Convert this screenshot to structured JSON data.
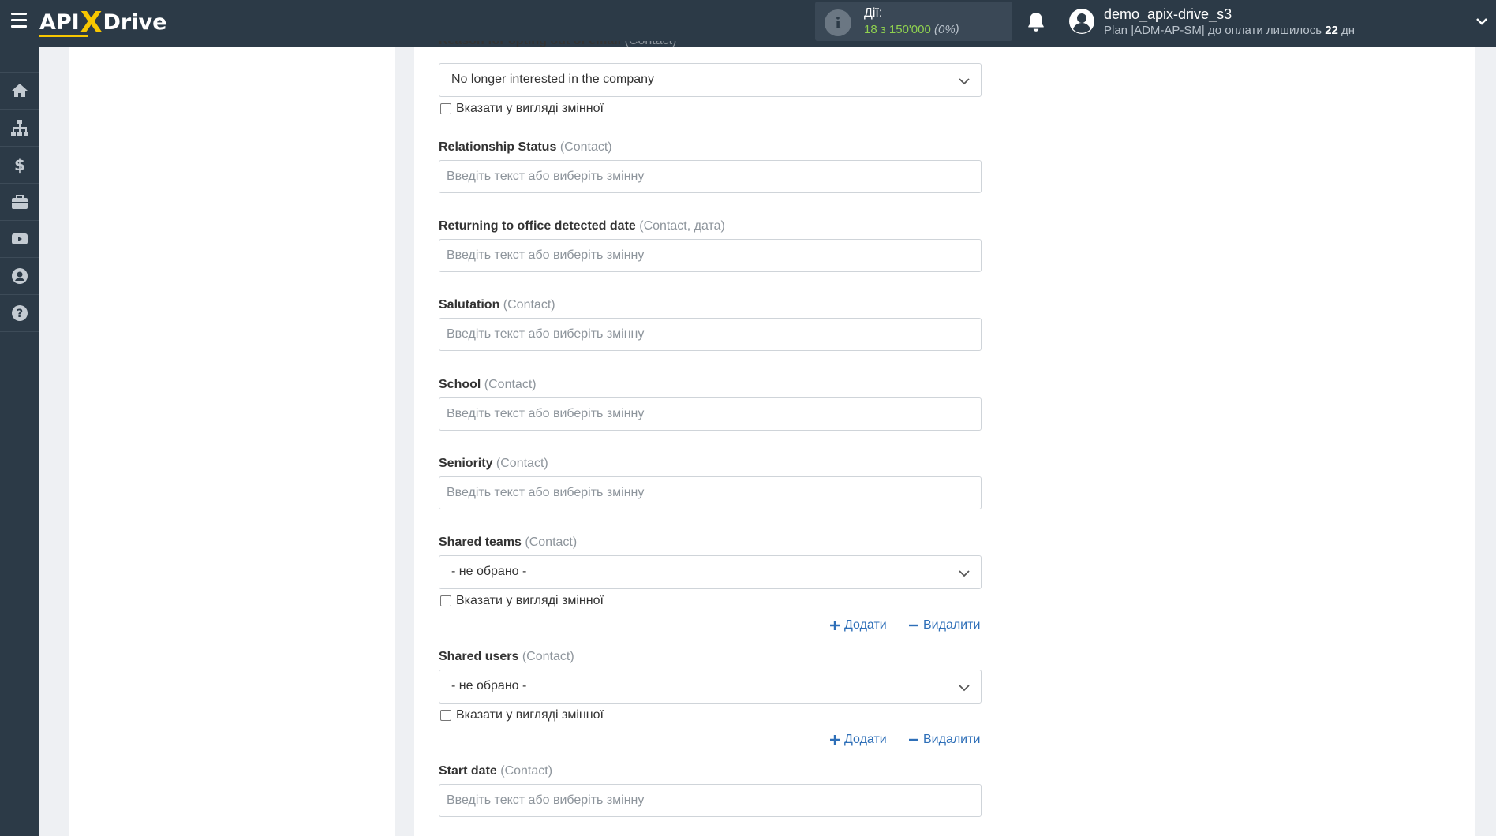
{
  "header": {
    "logo": {
      "left": "API",
      "x": "X",
      "right": "Drive"
    },
    "actions_label": "Дії:",
    "actions_value": "18 з 150'000",
    "actions_percent": "(0%)",
    "user_name": "demo_apix-drive_s3",
    "plan_prefix": "Plan |ADM-AP-SM| до оплати лишилось ",
    "plan_days": "22",
    "plan_suffix": " дн"
  },
  "sidebar": {
    "items": [
      "home-icon",
      "sitemap-icon",
      "dollar-icon",
      "briefcase-icon",
      "video-icon",
      "user-icon",
      "help-icon"
    ]
  },
  "form": {
    "placeholder": "Введіть текст або виберіть змінну",
    "checkbox_label": "Вказати у вигляді змінної",
    "add_label": "Додати",
    "remove_label": "Видалити",
    "fields": [
      {
        "label": "Reason for opting out of email",
        "hint": "(Contact)",
        "type": "select",
        "value": "No longer interested in the company"
      },
      {
        "label": "Relationship Status",
        "hint": "(Contact)",
        "type": "text"
      },
      {
        "label": "Returning to office detected date",
        "hint": "(Contact, дата)",
        "type": "text"
      },
      {
        "label": "Salutation",
        "hint": "(Contact)",
        "type": "text"
      },
      {
        "label": "School",
        "hint": "(Contact)",
        "type": "text"
      },
      {
        "label": "Seniority",
        "hint": "(Contact)",
        "type": "text"
      },
      {
        "label": "Shared teams",
        "hint": "(Contact)",
        "type": "select",
        "value": "- не обрано -"
      },
      {
        "label": "Shared users",
        "hint": "(Contact)",
        "type": "select",
        "value": "- не обрано -"
      },
      {
        "label": "Start date",
        "hint": "(Contact)",
        "type": "text"
      }
    ]
  },
  "colors": {
    "topbar": "#2c3a47",
    "accent": "#f7c600",
    "link": "#2e6fb8",
    "green": "#8fd14f"
  }
}
